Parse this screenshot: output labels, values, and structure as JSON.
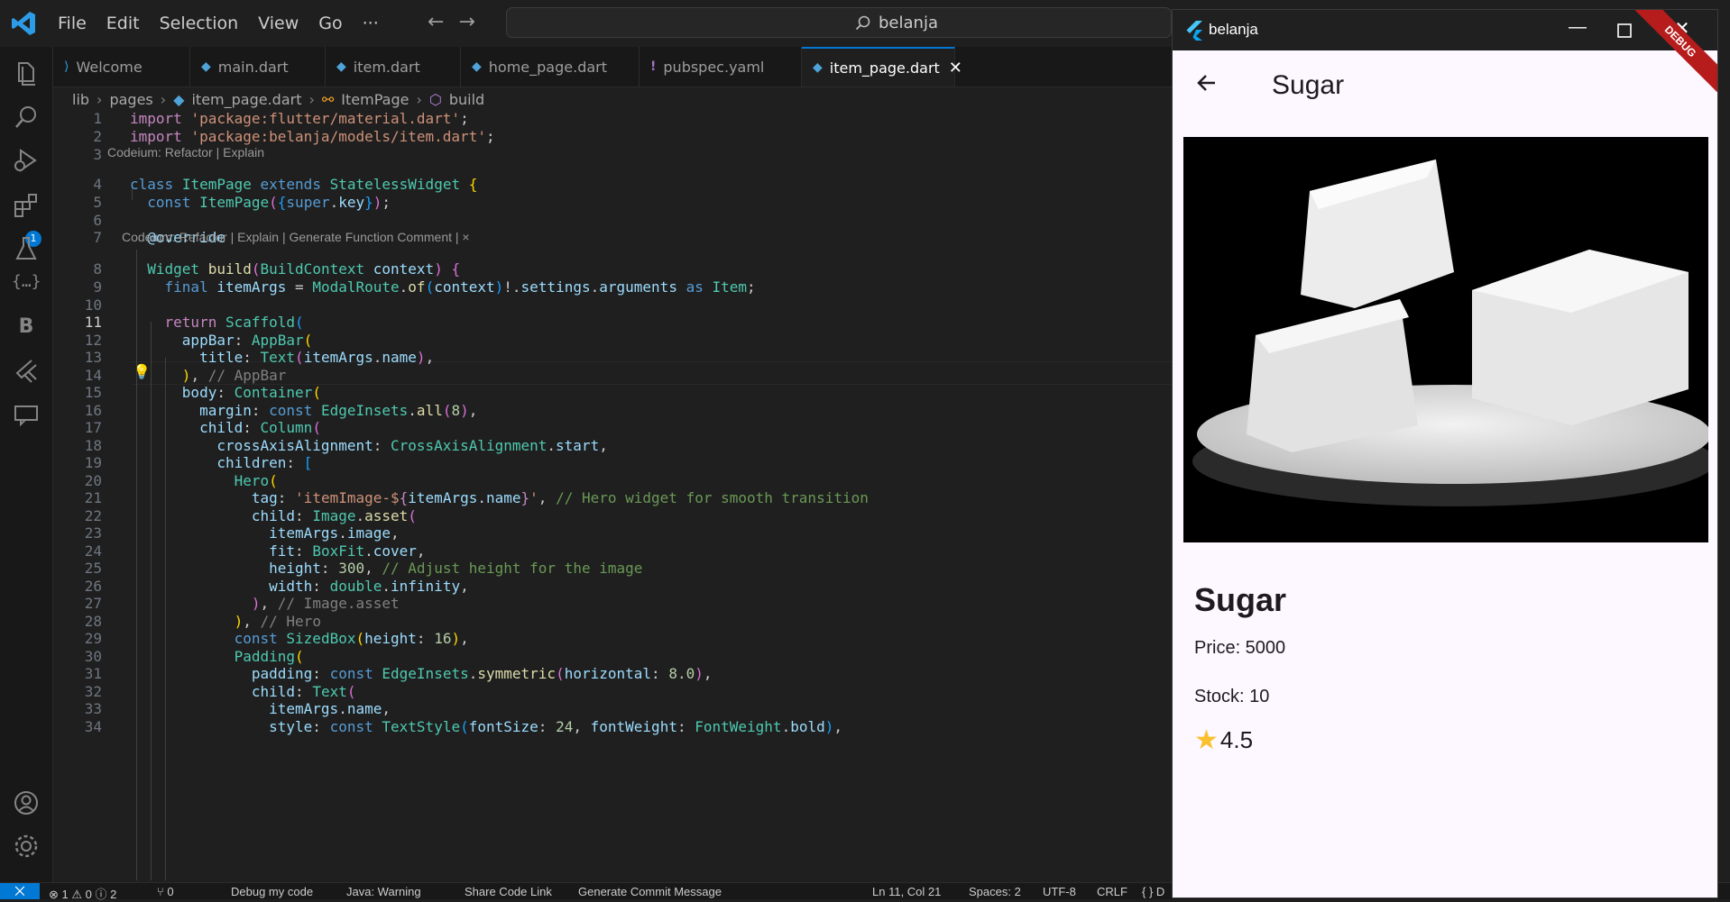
{
  "menu": [
    "File",
    "Edit",
    "Selection",
    "View",
    "Go",
    "···"
  ],
  "search": {
    "text": "belanja"
  },
  "activity_badge": "1",
  "tabs": [
    {
      "label": "Welcome",
      "icon": "vscode-icon"
    },
    {
      "label": "main.dart",
      "icon": "dart-icon"
    },
    {
      "label": "item.dart",
      "icon": "dart-icon"
    },
    {
      "label": "home_page.dart",
      "icon": "dart-icon"
    },
    {
      "label": "pubspec.yaml",
      "icon": "yaml-icon"
    },
    {
      "label": "item_page.dart",
      "icon": "dart-icon",
      "active": true
    }
  ],
  "breadcrumb": [
    "lib",
    "pages",
    "item_page.dart",
    "ItemPage",
    "build"
  ],
  "codelens": {
    "class": "Codeium: Refactor | Explain",
    "build": "Codeium: Refactor | Explain | Generate Function Comment | ×"
  },
  "line_numbers": [
    "1",
    "2",
    "3",
    "4",
    "5",
    "6",
    "7",
    "8",
    "9",
    "10",
    "11",
    "12",
    "13",
    "14",
    "15",
    "16",
    "17",
    "18",
    "19",
    "20",
    "21",
    "22",
    "23",
    "24",
    "25",
    "26",
    "27",
    "28",
    "29",
    "30",
    "31",
    "32",
    "33",
    "34"
  ],
  "current_line": "11",
  "status": {
    "problems": "⊗ 1 ⚠ 0 ⓘ 2",
    "ports": "⑂ 0",
    "debug": "Debug my code",
    "java": "Java: Warning",
    "share": "Share Code Link",
    "commit": "Generate Commit Message",
    "position": "Ln 11, Col 21",
    "spaces": "Spaces: 2",
    "encoding": "UTF-8",
    "eol": "CRLF",
    "lang": "{ }  D"
  },
  "flutter_app": {
    "window_title": "belanja",
    "appbar_title": "Sugar",
    "debug_banner": "DEBUG",
    "product_name": "Sugar",
    "price": "Price: 5000",
    "stock": "Stock: 10",
    "rating": "4.5",
    "star_color": "#fbc02d"
  },
  "colors": {
    "accent": "#0078d4",
    "editor_bg": "#1f1f1f",
    "app_bg": "#fdf7ff"
  }
}
